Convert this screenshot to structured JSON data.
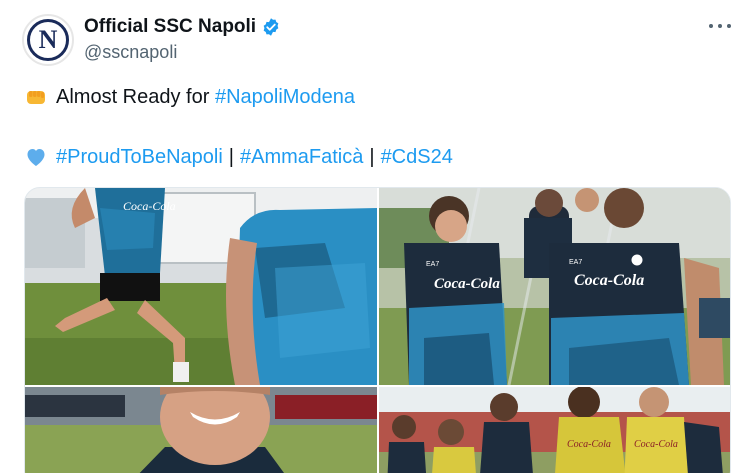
{
  "account": {
    "display_name": "Official SSC Napoli",
    "handle": "@sscnapoli",
    "avatar_letter": "N",
    "verified": true
  },
  "tweet": {
    "line1_prefix": "Almost Ready for",
    "line1_hashtag": "#NapoliModena",
    "line2_hashtags": [
      "#ProudToBeNapoli",
      "#AmmaFaticà",
      "#CdS24"
    ],
    "separator": "|"
  },
  "media": {
    "shirt_sponsor": "Coca-Cola",
    "kit_brand": "EA7",
    "images": [
      "training-sprint-photo",
      "players-group-photo",
      "player-smile-photo",
      "players-bibs-photo"
    ]
  },
  "colors": {
    "link": "#1d9bf0",
    "verified": "#1d9bf0",
    "napoli_navy": "#1a2b5a",
    "secondary_text": "#536471"
  },
  "icons": {
    "more": "more-options-icon",
    "verified": "verified-badge-icon",
    "line1_emoji": "fist-bump-emoji",
    "line2_emoji": "blue-heart-emoji"
  }
}
